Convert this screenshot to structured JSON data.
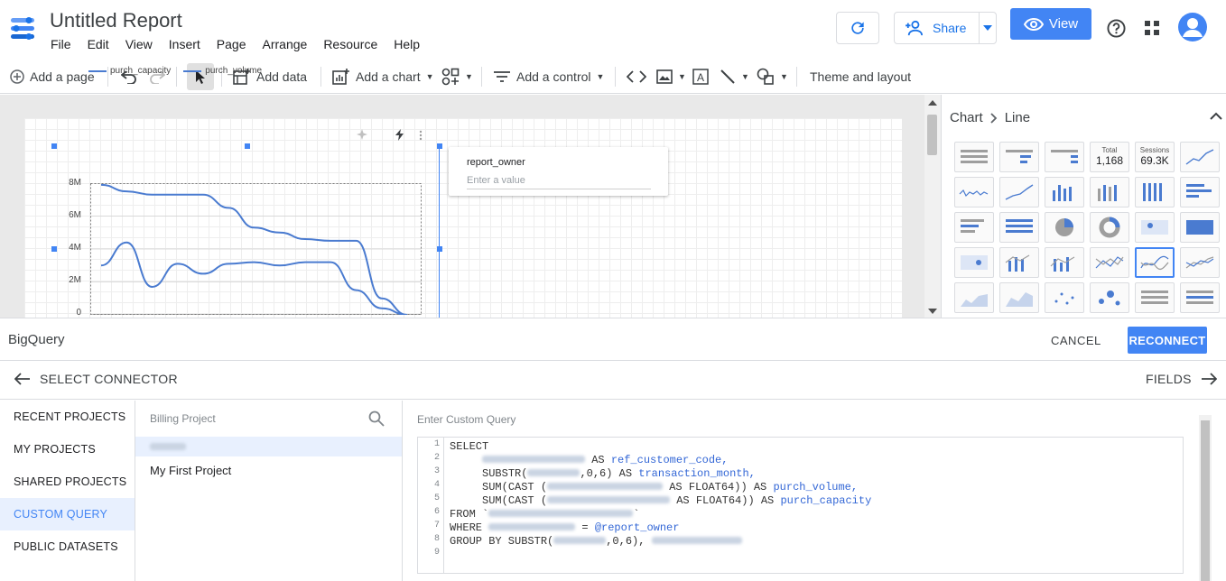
{
  "header": {
    "title": "Untitled Report",
    "menu": [
      "File",
      "Edit",
      "View",
      "Insert",
      "Page",
      "Arrange",
      "Resource",
      "Help"
    ],
    "share_label": "Share",
    "view_label": "View"
  },
  "toolbar": {
    "add_page": "Add a page",
    "add_data": "Add data",
    "add_chart": "Add a chart",
    "add_control": "Add a control",
    "theme_layout": "Theme and layout"
  },
  "canvas": {
    "legend": [
      "purch_capacity",
      "purch_volume"
    ],
    "y_ticks": [
      "8M",
      "6M",
      "4M",
      "2M",
      "0"
    ],
    "control_label": "report_owner",
    "control_placeholder": "Enter a value"
  },
  "chart_data": {
    "type": "line",
    "ylim": [
      0,
      8000000
    ],
    "series": [
      {
        "name": "purch_capacity",
        "values": [
          7900000,
          7500000,
          7300000,
          7300000,
          7300000,
          6500000,
          5300000,
          5000000,
          4600000,
          4500000,
          4500000,
          1000000,
          0
        ]
      },
      {
        "name": "purch_volume",
        "values": [
          3000000,
          4400000,
          1700000,
          3100000,
          2500000,
          3100000,
          3200000,
          3000000,
          3200000,
          3200000,
          1500000,
          400000,
          0
        ]
      }
    ]
  },
  "side_panel": {
    "crumb_root": "Chart",
    "crumb_leaf": "Line",
    "tiles": [
      {
        "kind": "table"
      },
      {
        "kind": "table-bars"
      },
      {
        "kind": "table-heatmap"
      },
      {
        "kind": "scorecard",
        "label": "Total",
        "value": "1,168"
      },
      {
        "kind": "scorecard",
        "label": "Sessions",
        "value": "69.3K"
      },
      {
        "kind": "spark"
      },
      {
        "kind": "timeseries"
      },
      {
        "kind": "line"
      },
      {
        "kind": "column"
      },
      {
        "kind": "column-stacked"
      },
      {
        "kind": "column-100"
      },
      {
        "kind": "bar"
      },
      {
        "kind": "bar-h"
      },
      {
        "kind": "bar-h-stacked"
      },
      {
        "kind": "pie"
      },
      {
        "kind": "donut"
      },
      {
        "kind": "geo"
      },
      {
        "kind": "geo-filled"
      },
      {
        "kind": "geo2"
      },
      {
        "kind": "combo"
      },
      {
        "kind": "combo2"
      },
      {
        "kind": "line2"
      },
      {
        "kind": "line-smooth",
        "selected": true
      },
      {
        "kind": "line3"
      },
      {
        "kind": "area"
      },
      {
        "kind": "area2"
      },
      {
        "kind": "scatter"
      },
      {
        "kind": "bubble"
      },
      {
        "kind": "pivot"
      },
      {
        "kind": "pivot2"
      }
    ]
  },
  "bigquery": {
    "name": "BigQuery",
    "cancel": "CANCEL",
    "reconnect": "RECONNECT",
    "select_connector": "SELECT CONNECTOR",
    "fields": "FIELDS",
    "nav": [
      "RECENT PROJECTS",
      "MY PROJECTS",
      "SHARED PROJECTS",
      "CUSTOM QUERY",
      "PUBLIC DATASETS"
    ],
    "active_nav": "CUSTOM QUERY",
    "billing_header": "Billing Project",
    "billing_projects": [
      "My First Project"
    ],
    "query_label": "Enter Custom Query",
    "line_numbers": [
      "1",
      "2",
      "3",
      "4",
      "5",
      "6",
      "7",
      "8",
      "9"
    ]
  },
  "sql": {
    "l1": "SELECT",
    "l2_kw": "AS",
    "l2_id": "ref_customer_code,",
    "l3_a": "SUBSTR(",
    "l3_b": ",0,6) AS",
    "l3_id": "transaction_month,",
    "l4_a": "SUM(CAST (",
    "l4_b": "AS FLOAT64)) AS",
    "l4_id": "purch_volume,",
    "l5_a": "SUM(CAST (",
    "l5_b": "AS FLOAT64)) AS",
    "l5_id": "purch_capacity",
    "l6": "FROM `",
    "l7_a": "WHERE",
    "l7_b": "=",
    "l7_id": "@report_owner",
    "l8_a": "GROUP BY SUBSTR(",
    "l8_b": ",0,6),"
  },
  "colors": {
    "accent": "#4285f4",
    "chart_line": "#4a7bd0"
  }
}
